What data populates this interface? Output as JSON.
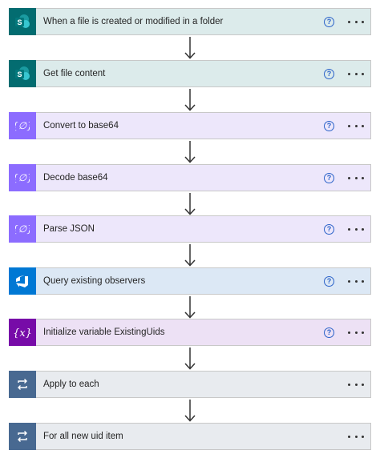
{
  "steps": [
    {
      "label": "When a file is created or modified in a folder",
      "icon": "sharepoint-icon",
      "bg": "#dcebeb",
      "iconBg": "#036c70",
      "help": true
    },
    {
      "label": "Get file content",
      "icon": "sharepoint-icon",
      "bg": "#dcebeb",
      "iconBg": "#036c70",
      "help": true
    },
    {
      "label": "Convert to base64",
      "icon": "data-operation-icon",
      "bg": "#ede7fb",
      "iconBg": "#8c6cff",
      "help": true
    },
    {
      "label": "Decode base64",
      "icon": "data-operation-icon",
      "bg": "#ede7fb",
      "iconBg": "#8c6cff",
      "help": true
    },
    {
      "label": "Parse JSON",
      "icon": "data-operation-icon",
      "bg": "#ede7fb",
      "iconBg": "#8c6cff",
      "help": true
    },
    {
      "label": "Query existing observers",
      "icon": "azure-devops-icon",
      "bg": "#dce8f5",
      "iconBg": "#0078d4",
      "help": true
    },
    {
      "label": "Initialize variable ExistingUids",
      "icon": "variable-icon",
      "bg": "#ede1f5",
      "iconBg": "#770ba8",
      "help": true
    },
    {
      "label": "Apply to each",
      "icon": "loop-icon",
      "bg": "#e8ebef",
      "iconBg": "#486991",
      "help": false
    },
    {
      "label": "For all new uid item",
      "icon": "loop-icon",
      "bg": "#e8ebef",
      "iconBg": "#486991",
      "help": false
    }
  ],
  "help_glyph": "?"
}
